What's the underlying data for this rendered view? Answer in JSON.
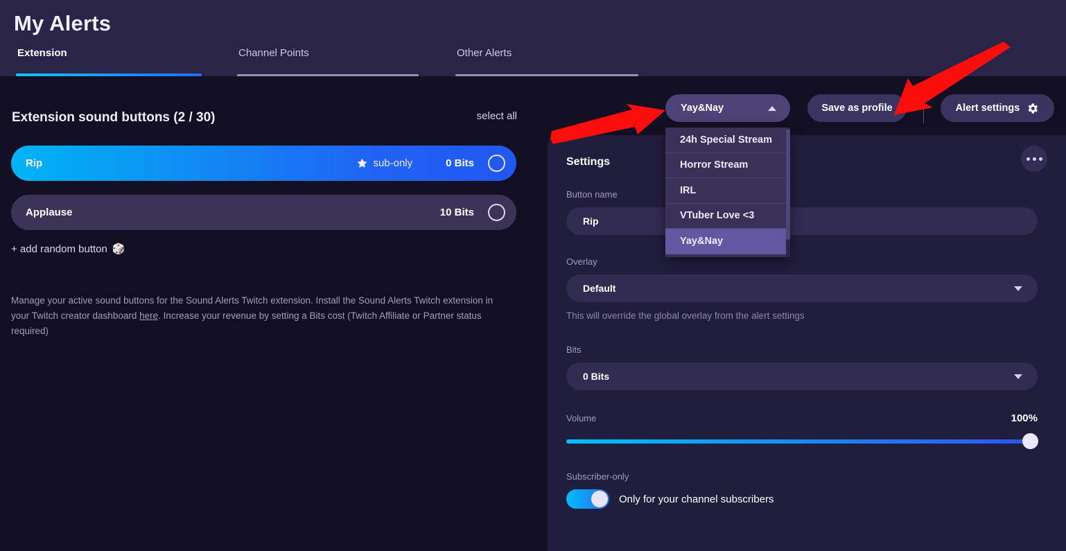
{
  "header": {
    "title": "My Alerts",
    "tabs": [
      {
        "label": "Extension",
        "active": true
      },
      {
        "label": "Channel Points",
        "active": false
      },
      {
        "label": "Other Alerts",
        "active": false
      }
    ]
  },
  "left": {
    "section_title": "Extension sound buttons (2 / 30)",
    "select_all_label": "select all",
    "sound_buttons": [
      {
        "name": "Rip",
        "badge": "sub-only",
        "bits": "0 Bits",
        "selected": true
      },
      {
        "name": "Applause",
        "badge": "",
        "bits": "10 Bits",
        "selected": false
      }
    ],
    "add_random_label": "+ add random button",
    "add_random_icon": "dice-icon",
    "dice_glyph": "🎲",
    "blurb_part1": "Manage your active sound buttons for the Sound Alerts Twitch extension. Install the Sound Alerts Twitch extension in your Twitch creator dashboard ",
    "blurb_link": "here",
    "blurb_part2": ". Increase your revenue by setting a Bits cost (Twitch Affiliate or Partner status required)"
  },
  "toolbar": {
    "profile_value": "Yay&Nay",
    "save_profile_label": "Save as profile",
    "alert_settings_label": "Alert settings",
    "gear_icon": "gear-icon",
    "caret_up_icon": "chevron-up-icon"
  },
  "profile_dropdown": {
    "open": true,
    "options": [
      {
        "label": "24h Special Stream",
        "selected": false
      },
      {
        "label": "Horror Stream",
        "selected": false
      },
      {
        "label": "IRL",
        "selected": false
      },
      {
        "label": "VTuber Love <3",
        "selected": false
      },
      {
        "label": "Yay&Nay",
        "selected": true
      }
    ]
  },
  "settings": {
    "title": "Settings",
    "kebab_icon": "more-options-icon",
    "button_name": {
      "label": "Button name",
      "value": "Rip"
    },
    "overlay": {
      "label": "Overlay",
      "value": "Default",
      "hint": "This will override the global overlay from the alert settings"
    },
    "bits": {
      "label": "Bits",
      "value": "0 Bits"
    },
    "volume": {
      "label": "Volume",
      "value": "100%",
      "percent": 100
    },
    "subscriber_only": {
      "label": "Subscriber-only",
      "toggle_on": true,
      "text": "Only for your channel subscribers"
    }
  },
  "annotations": {
    "arrow_color": "#fa0d0d",
    "arrows": [
      {
        "name": "arrow-pointing-to-profile-dropdown",
        "direction": "right"
      },
      {
        "name": "arrow-pointing-to-alert-settings",
        "direction": "down-left"
      }
    ]
  },
  "colors": {
    "header_bg": "#2a2449",
    "left_panel_bg": "#120f22",
    "right_panel_bg": "#211d3d",
    "accent_gradient_start": "#00b4f5",
    "accent_gradient_end": "#2057f0",
    "dropdown_bg": "#3a3159",
    "dropdown_selected": "#6257a0"
  }
}
